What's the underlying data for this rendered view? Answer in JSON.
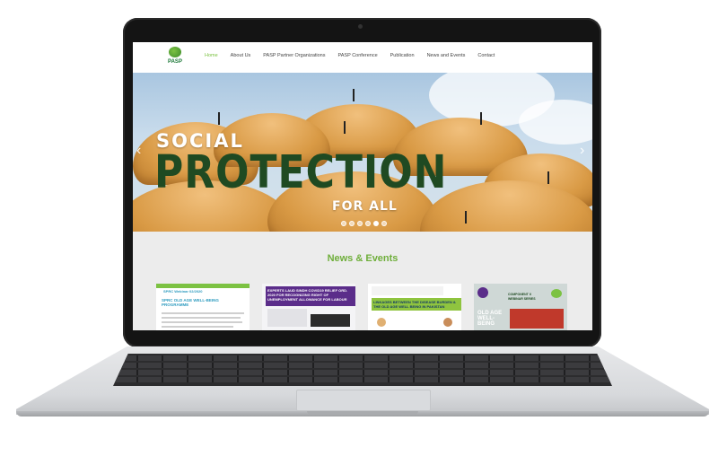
{
  "logo": {
    "text": "PASP"
  },
  "nav": {
    "items": [
      {
        "label": "Home",
        "active": true
      },
      {
        "label": "About Us",
        "active": false
      },
      {
        "label": "PASP Partner Organizations",
        "active": false
      },
      {
        "label": "PASP Conference",
        "active": false
      },
      {
        "label": "Publication",
        "active": false
      },
      {
        "label": "News and Events",
        "active": false
      },
      {
        "label": "Contact",
        "active": false
      }
    ]
  },
  "hero": {
    "line1": "SOCIAL",
    "line2": "PROTECTION",
    "line3": "FOR ALL",
    "prev_icon": "chevron-left-icon",
    "next_icon": "chevron-right-icon",
    "slides_count": 6,
    "active_slide": 4
  },
  "news": {
    "title": "News & Events",
    "cards": [
      {
        "headline": "SPRC OLD AGE WELL-BEING PROGRAMME",
        "sub": "SPRC Webinar 02/2020",
        "accent": "#2e9bbf"
      },
      {
        "headline": "EXPERTS LAUD SINDH COVID19 RELIEF ORD. 2020 FOR RECOGNIZING RIGHT OF UNEMPLOYMENT ALLOWANCE FOR LABOUR",
        "sub": "",
        "accent": "#5b2d8a"
      },
      {
        "headline": "LINKAGES BETWEEN THE DISEASE BURDEN & THE OLD AGE WELL BEING IN PAKISTAN",
        "sub": "",
        "accent": "#3a7bbf"
      },
      {
        "headline": "OLD AGE WELL-BEING",
        "sub": "COMPONENT II WEBINAR SERIES",
        "accent": "#c0392b"
      }
    ]
  },
  "colors": {
    "accent_green": "#7cc242",
    "brand_dark_green": "#1f4a22",
    "news_title_green": "#6fae3b"
  }
}
